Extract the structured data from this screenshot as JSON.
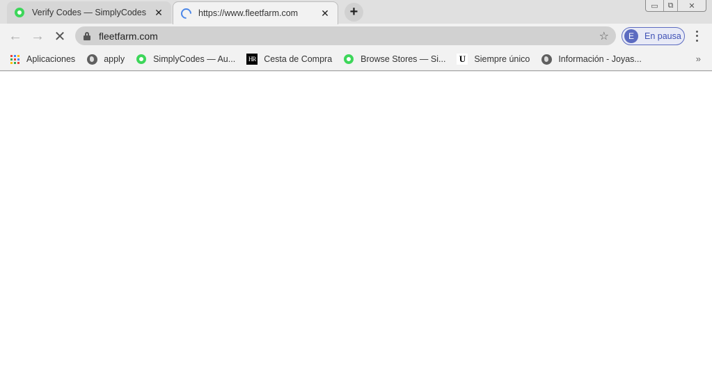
{
  "tabs": [
    {
      "title": "Verify Codes — SimplyCodes",
      "favicon": "green-ring-icon",
      "active": false,
      "close_label": "✕"
    },
    {
      "title": "https://www.fleetfarm.com",
      "favicon": "loading-spinner-icon",
      "active": true,
      "close_label": "✕"
    }
  ],
  "new_tab_label": "+",
  "window_controls": {
    "minimize": "▭",
    "restore": "⧉",
    "close": "✕"
  },
  "toolbar": {
    "back_icon": "←",
    "forward_icon": "→",
    "stop_icon": "✕",
    "url": "fleetfarm.com",
    "bookmark_star": "☆",
    "profile": {
      "initial": "E",
      "label": "En pausa",
      "color": "#5c6bc0"
    }
  },
  "bookmarks": [
    {
      "label": "Aplicaciones",
      "icon": "apps-grid-icon"
    },
    {
      "label": "apply",
      "icon": "globe-icon"
    },
    {
      "label": "SimplyCodes — Au...",
      "icon": "green-ring-icon"
    },
    {
      "label": "Cesta de Compra",
      "icon": "hr-logo-icon",
      "icon_text": "HR"
    },
    {
      "label": "Browse Stores — Si...",
      "icon": "green-ring-icon"
    },
    {
      "label": "Siempre único",
      "icon": "u-logo-icon",
      "icon_text": "U"
    },
    {
      "label": "Información - Joyas...",
      "icon": "globe-icon"
    }
  ],
  "bookmarks_overflow": "»",
  "colors": {
    "accent_green": "#3dd65a",
    "spinner_blue": "#4a86e8",
    "profile_indigo": "#5c6bc0"
  }
}
